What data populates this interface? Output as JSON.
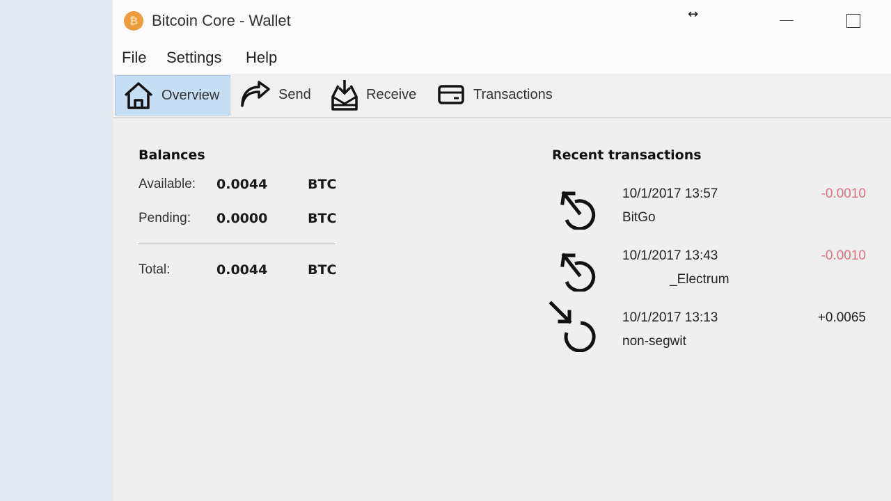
{
  "window": {
    "title": "Bitcoin Core - Wallet",
    "app_icon_glyph": "₿",
    "resize_cursor_glyph": "↔"
  },
  "menu": [
    "File",
    "Settings",
    "Help"
  ],
  "toolbar": [
    {
      "label": "Overview",
      "icon": "home-icon",
      "active": true
    },
    {
      "label": "Send",
      "icon": "send-arrow-icon",
      "active": false
    },
    {
      "label": "Receive",
      "icon": "receive-inbox-icon",
      "active": false
    },
    {
      "label": "Transactions",
      "icon": "card-icon",
      "active": false
    }
  ],
  "balances": {
    "title": "Balances",
    "available": {
      "label": "Available:",
      "value": "0.0044",
      "unit": "BTC"
    },
    "pending": {
      "label": "Pending:",
      "value": "0.0000",
      "unit": "BTC"
    },
    "total": {
      "label": "Total:",
      "value": "0.0044",
      "unit": "BTC"
    }
  },
  "recent": {
    "title": "Recent transactions",
    "items": [
      {
        "date": "10/1/2017 13:57",
        "label": "BitGo",
        "amount": "-0.0010",
        "direction": "sent"
      },
      {
        "date": "10/1/2017 13:43",
        "label": "_Electrum",
        "amount": "-0.0010",
        "direction": "sent"
      },
      {
        "date": "10/1/2017 13:13",
        "label": "non-segwit",
        "amount": "+0.0065",
        "direction": "received"
      }
    ]
  },
  "colors": {
    "negative": "#d9727f",
    "positive": "#222222",
    "active_tab": "#c5def3",
    "bitcoin_orange": "#ec9c3a"
  }
}
